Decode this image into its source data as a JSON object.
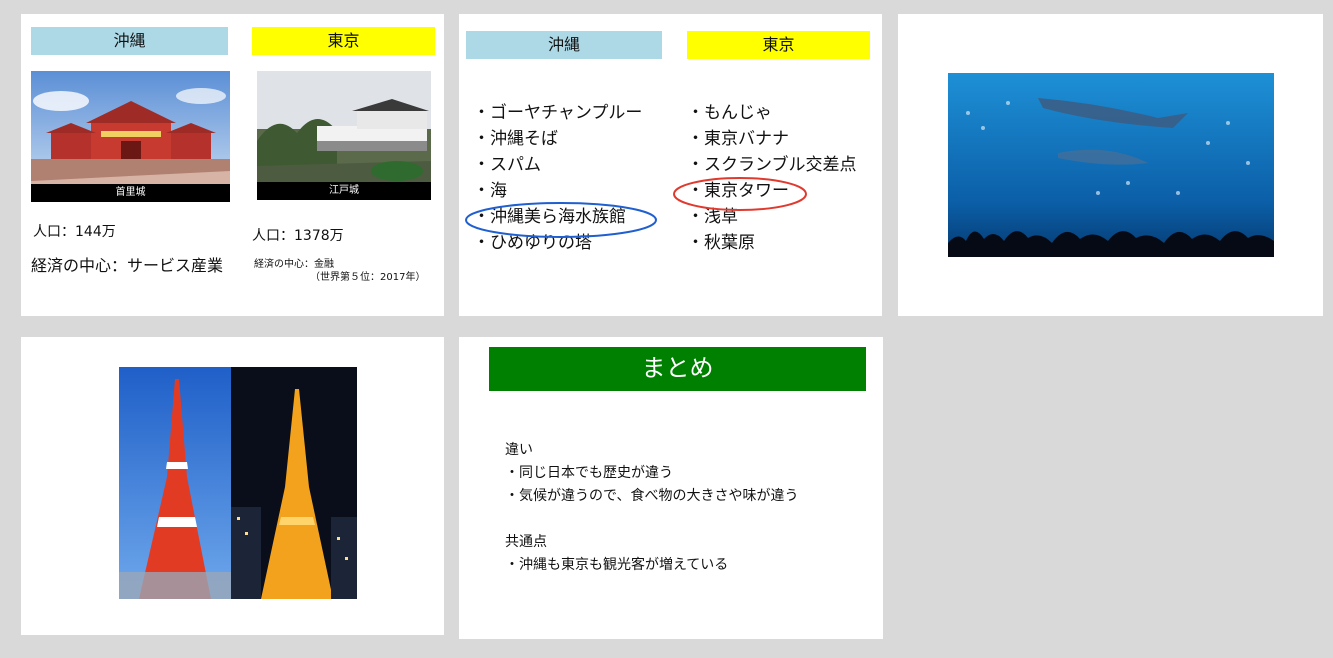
{
  "slide1": {
    "left_header": "沖縄",
    "right_header": "東京",
    "left_caption": "首里城",
    "right_caption": "江戸城",
    "left_population": "人口：144万",
    "left_economy": "経済の中心：サービス産業",
    "right_population": "人口：1378万",
    "right_economy_line1": "経済の中心：金融",
    "right_economy_line2": "（世界第５位：2017年）"
  },
  "slide2": {
    "left_header": "沖縄",
    "right_header": "東京",
    "left_items": [
      "・ゴーヤチャンプルー",
      "・沖縄そば",
      "・スパム",
      "・海",
      "・沖縄美ら海水族館",
      "・ひめゆりの塔"
    ],
    "right_items": [
      "・もんじゃ",
      "・東京バナナ",
      "・スクランブル交差点",
      "・東京タワー",
      "・浅草",
      "・秋葉原"
    ],
    "left_highlight_index": 4,
    "right_highlight_index": 3,
    "left_highlight_color": "#1f5fcf",
    "right_highlight_color": "#e03a2f"
  },
  "slide5": {
    "title": "まとめ",
    "diff_heading": "違い",
    "diff_items": [
      "・同じ日本でも歴史が違う",
      "・気候が違うので、食べ物の大きさや味が違う"
    ],
    "common_heading": "共通点",
    "common_items": [
      "・沖縄も東京も観光客が増えている"
    ]
  },
  "colors": {
    "okinawa_header": "#add8e6",
    "tokyo_header": "#ffff00",
    "summary_bar": "#008000",
    "background": "#d9d9d9"
  }
}
